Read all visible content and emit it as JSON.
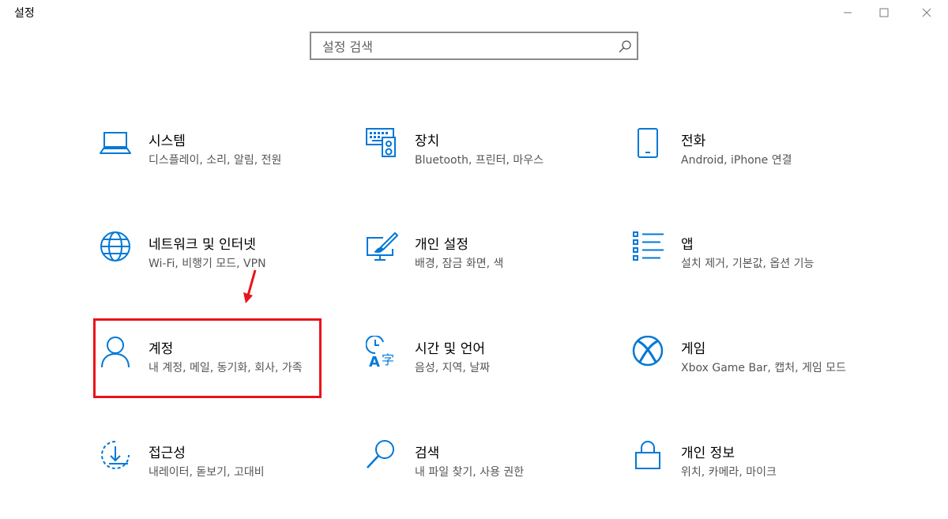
{
  "window": {
    "title": "설정"
  },
  "search": {
    "placeholder": "설정 검색",
    "value": ""
  },
  "tiles": [
    {
      "name": "시스템",
      "desc": "디스플레이, 소리, 알림, 전원",
      "icon": "laptop-icon"
    },
    {
      "name": "장치",
      "desc": "Bluetooth, 프린터, 마우스",
      "icon": "devices-icon"
    },
    {
      "name": "전화",
      "desc": "Android, iPhone 연결",
      "icon": "phone-icon"
    },
    {
      "name": "네트워크 및 인터넷",
      "desc": "Wi-Fi, 비행기 모드, VPN",
      "icon": "globe-icon"
    },
    {
      "name": "개인 설정",
      "desc": "배경, 잠금 화면, 색",
      "icon": "personalization-icon"
    },
    {
      "name": "앱",
      "desc": "설치 제거, 기본값, 옵션 기능",
      "icon": "apps-list-icon"
    },
    {
      "name": "계정",
      "desc": "내 계정, 메일, 동기화, 회사, 가족",
      "icon": "person-icon"
    },
    {
      "name": "시간 및 언어",
      "desc": "음성, 지역, 날짜",
      "icon": "time-language-icon"
    },
    {
      "name": "게임",
      "desc": "Xbox Game Bar, 캡처, 게임 모드",
      "icon": "xbox-icon"
    },
    {
      "name": "접근성",
      "desc": "내레이터, 돋보기, 고대비",
      "icon": "ease-of-access-icon"
    },
    {
      "name": "검색",
      "desc": "내 파일 찾기, 사용 권한",
      "icon": "search-icon"
    },
    {
      "name": "개인 정보",
      "desc": "위치, 카메라, 마이크",
      "icon": "lock-icon"
    }
  ],
  "colors": {
    "accent": "#0078d7",
    "highlight": "#e8141b"
  }
}
